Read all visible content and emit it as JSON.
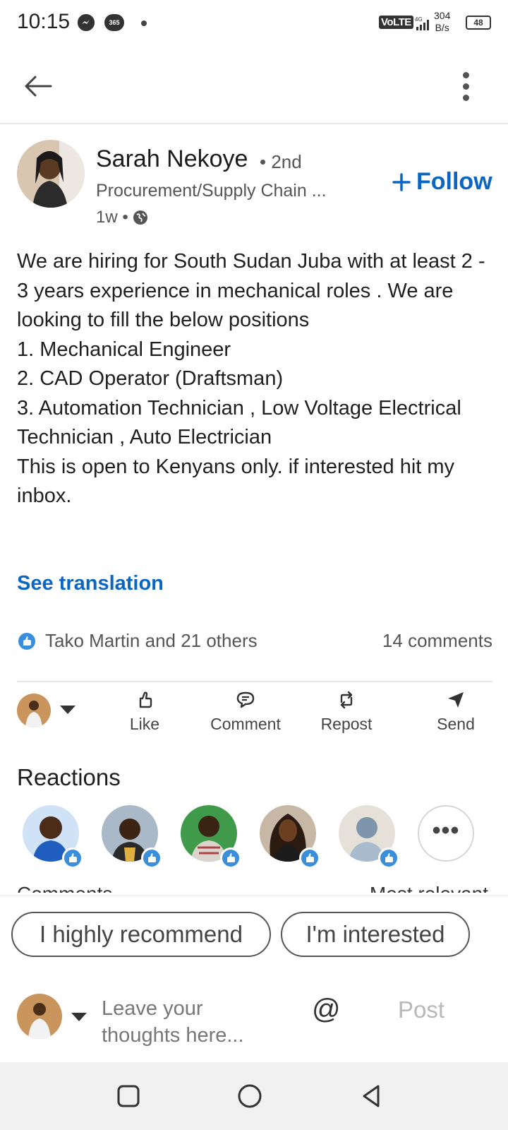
{
  "status_bar": {
    "time": "10:15",
    "icon_messenger": "messenger-icon",
    "icon_365": "365",
    "network": "VoLTE",
    "network_type": "4G",
    "speed_value": "304",
    "speed_unit": "B/s",
    "battery": "48"
  },
  "post": {
    "author": {
      "name": "Sarah Nekoye",
      "degree": "• 2nd",
      "headline": "Procurement/Supply Chain ...",
      "time": "1w •"
    },
    "follow_label": "Follow",
    "body": "We are hiring for South Sudan Juba with at least 2 - 3 years experience in mechanical roles .  We are looking to fill the below positions\n1. Mechanical Engineer\n2. CAD Operator (Draftsman)\n3. Automation Technician , Low Voltage Electrical Technician , Auto Electrician\nThis is open to Kenyans only. if interested hit my inbox.",
    "see_translation": "See translation",
    "reactions_summary": "Tako Martin and 21 others",
    "comments_count": "14 comments"
  },
  "actions": {
    "like": "Like",
    "comment": "Comment",
    "repost": "Repost",
    "send": "Send"
  },
  "reactions": {
    "title": "Reactions",
    "more_label": "•••"
  },
  "comments_section": {
    "title": "Comments",
    "sort": "Most relevant"
  },
  "compose": {
    "chips": [
      "I highly recommend",
      "I'm interested"
    ],
    "placeholder": "Leave your thoughts here...",
    "mention": "@",
    "post_label": "Post"
  },
  "colors": {
    "accent": "#0a66c2",
    "like_badge": "#3a8fdd"
  }
}
